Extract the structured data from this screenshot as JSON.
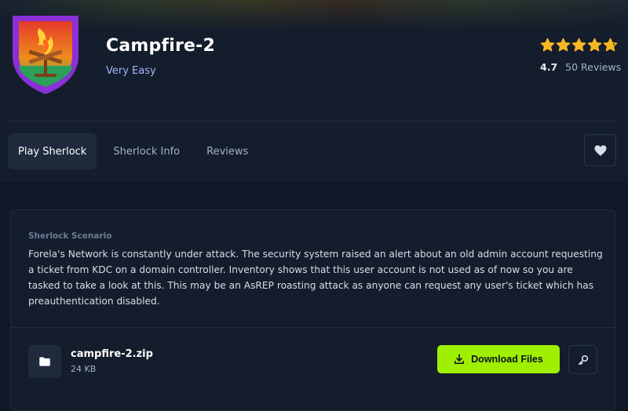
{
  "colors": {
    "background": "#141d2b",
    "accent_green": "#9fef00",
    "difficulty_text": "#9fb7ff",
    "star_gold": "#f7b824",
    "muted_text": "#a4b1cd"
  },
  "header": {
    "badge_icon": "campfire-shield-icon",
    "title": "Campfire-2",
    "difficulty": "Very Easy",
    "rating": {
      "value": "4.7",
      "stars": 4.7,
      "reviews": "50 Reviews"
    }
  },
  "tabs": [
    {
      "label": "Play Sherlock",
      "active": true
    },
    {
      "label": "Sherlock Info",
      "active": false
    },
    {
      "label": "Reviews",
      "active": false
    }
  ],
  "favorite_icon": "heart-icon",
  "scenario": {
    "label": "Sherlock Scenario",
    "text": "Forela's Network is constantly under attack. The security system raised an alert about an old admin account requesting a ticket from KDC on a domain controller. Inventory shows that this user account is not used as of now so you are tasked to take a look at this. This may be an AsREP roasting attack as anyone can request any user's ticket which has preauthentication disabled."
  },
  "file": {
    "icon": "folder-icon",
    "name": "campfire-2.zip",
    "size": "24 KB",
    "download_label": "Download Files",
    "download_icon": "download-icon",
    "key_icon": "key-icon"
  }
}
